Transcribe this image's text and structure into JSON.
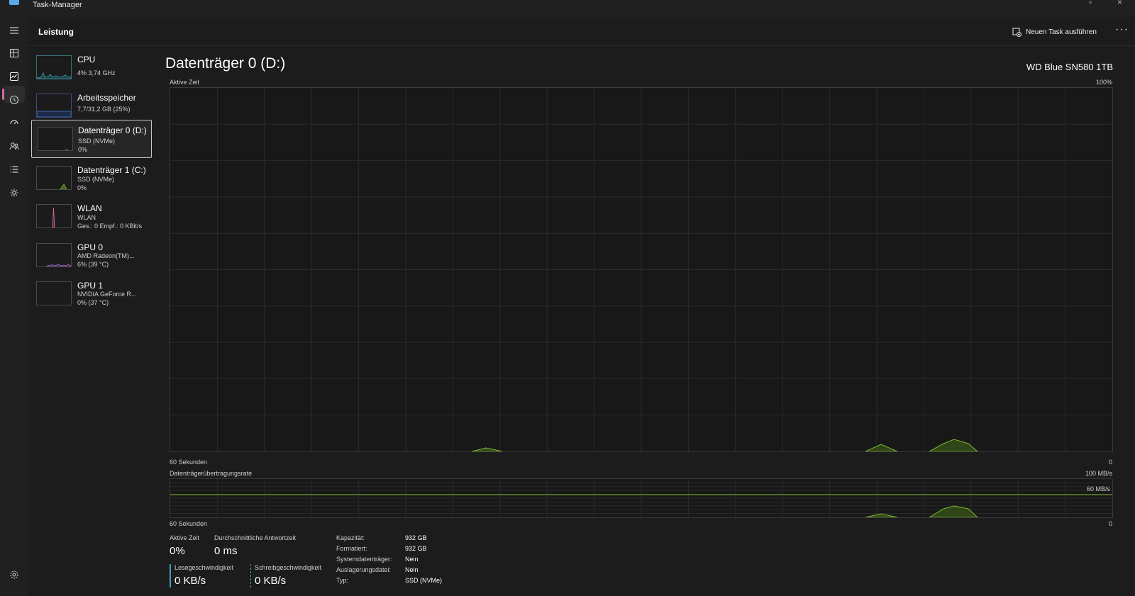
{
  "window": {
    "title": "Task-Manager"
  },
  "header": {
    "page_title": "Leistung",
    "new_task_label": "Neuen Task ausführen",
    "more_label": "···"
  },
  "rail": {
    "icons": [
      "hamburger-icon",
      "processes-icon",
      "performance-icon",
      "history-icon",
      "startup-icon",
      "users-icon",
      "details-icon",
      "services-icon",
      "settings-icon"
    ]
  },
  "sidebar": {
    "items": [
      {
        "name": "CPU",
        "sub1": "4% 3,74 GHz",
        "sub2": ""
      },
      {
        "name": "Arbeitsspeicher",
        "sub1": "7,7/31,2 GB (25%)",
        "sub2": ""
      },
      {
        "name": "Datenträger 0 (D:)",
        "sub1": "SSD (NVMe)",
        "sub2": "0%"
      },
      {
        "name": "Datenträger 1 (C:)",
        "sub1": "SSD (NVMe)",
        "sub2": "0%"
      },
      {
        "name": "WLAN",
        "sub1": "WLAN",
        "sub2": "Ges.: 0 Empf.: 0 KBit/s"
      },
      {
        "name": "GPU 0",
        "sub1": "AMD Radeon(TM)...",
        "sub2": "6% (39 °C)"
      },
      {
        "name": "GPU 1",
        "sub1": "NVIDIA GeForce R...",
        "sub2": "0% (37 °C)"
      }
    ]
  },
  "main": {
    "title": "Datenträger 0 (D:)",
    "model": "WD Blue SN580 1TB",
    "graph1": {
      "label": "Aktive Zeit",
      "max_label": "100%",
      "time_label": "60 Sekunden",
      "min_label": "0"
    },
    "graph2": {
      "label": "Datenträgerübertragungsrate",
      "max_label": "100 MB/s",
      "line_label": "60 MB/s",
      "time_label": "60 Sekunden",
      "min_label": "0"
    },
    "stats": {
      "active_time_label": "Aktive Zeit",
      "active_time_value": "0%",
      "response_label": "Durchschnittliche Antwortzeit",
      "response_value": "0 ms",
      "read_label": "Lesegeschwindigkeit",
      "read_value": "0 KB/s",
      "write_label": "Schreibgeschwindigkeit",
      "write_value": "0 KB/s"
    },
    "properties": [
      {
        "key": "Kapazität:",
        "value": "932 GB"
      },
      {
        "key": "Formatiert:",
        "value": "932 GB"
      },
      {
        "key": "Systemdatenträger:",
        "value": "Nein"
      },
      {
        "key": "Auslagerungsdatei:",
        "value": "Nein"
      },
      {
        "key": "Typ:",
        "value": "SSD (NVMe)"
      }
    ]
  },
  "colors": {
    "disk_accent": "#7fb82e",
    "cpu_accent": "#3aa6b9",
    "mem_accent": "#4a78d6",
    "wlan_accent": "#d46aa6",
    "gpu_accent": "#a06ad4",
    "nav_active": "#d46aa6"
  }
}
